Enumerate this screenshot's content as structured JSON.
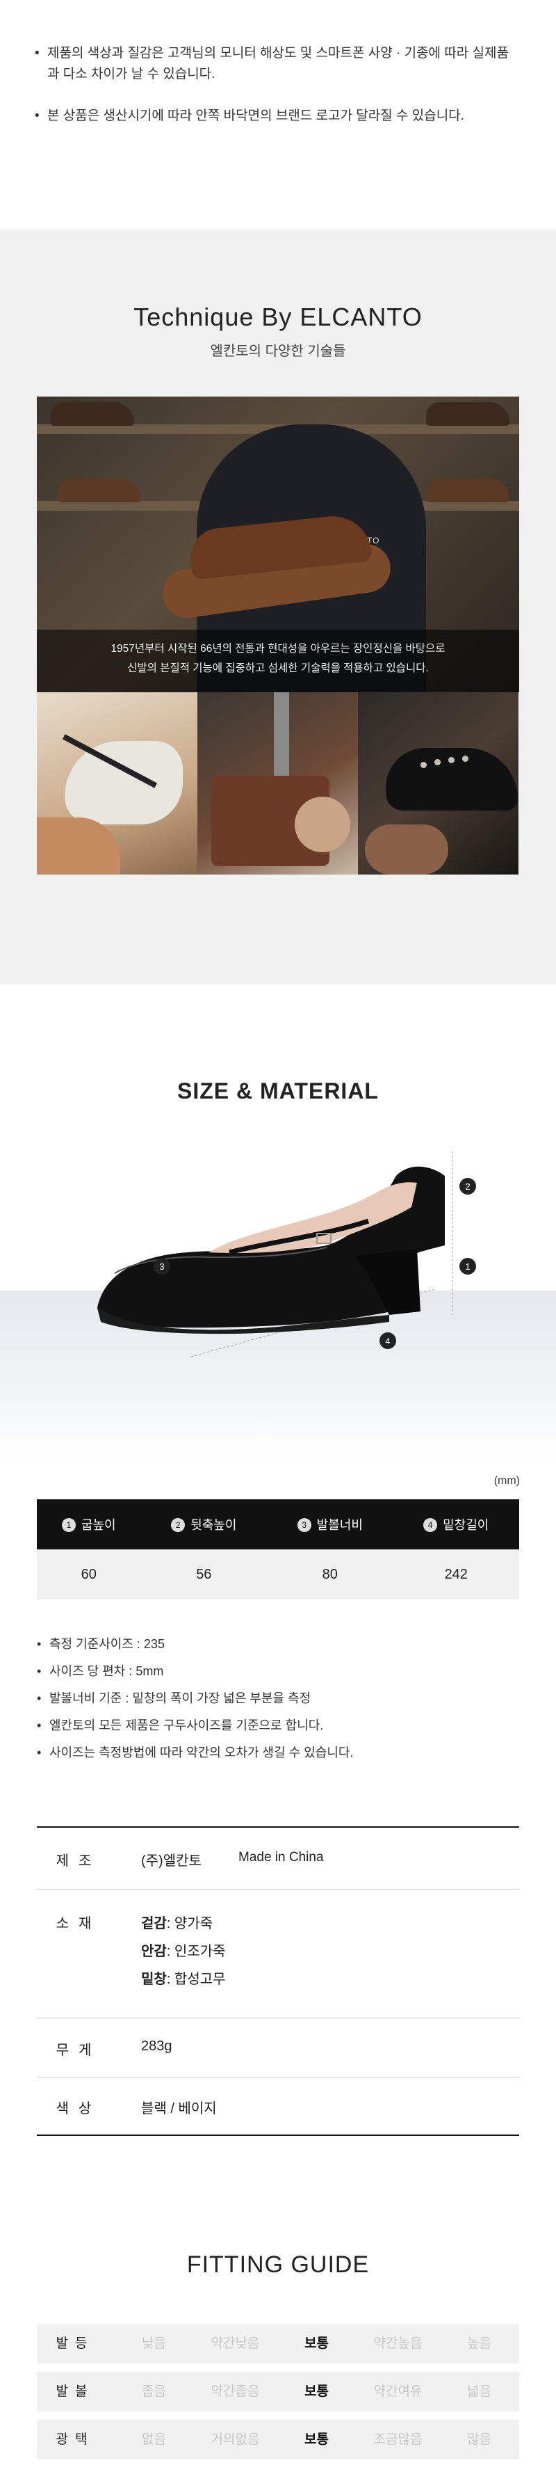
{
  "notice": {
    "items": [
      "제품의 색상과 질감은 고객님의 모니터 해상도 및 스마트폰 사양 · 기종에 따라 실제품과 다소 차이가 날 수 있습니다.",
      "본 상품은 생산시기에 따라 안쪽 바닥면의 브랜드 로고가 달라질 수 있습니다."
    ]
  },
  "technique": {
    "title": "Technique By ELCANTO",
    "subtitle": "엘칸토의 다양한 기술들",
    "caption_line1": "1957년부터 시작된 66년의 전통과 현대성을 아우르는 장인정신을 바탕으로",
    "caption_line2": "신발의 본질적 기능에 집중하고 섬세한 기술력을 적용하고 있습니다.",
    "jacket_logo": "ELCANTO"
  },
  "size": {
    "title": "SIZE & MATERIAL",
    "unit": "(mm)",
    "markers": [
      "1",
      "2",
      "3",
      "4"
    ],
    "headers": [
      {
        "num": "1",
        "label": "굽높이"
      },
      {
        "num": "2",
        "label": "뒷축높이"
      },
      {
        "num": "3",
        "label": "발볼너비"
      },
      {
        "num": "4",
        "label": "밑창길이"
      }
    ],
    "values": [
      "60",
      "56",
      "80",
      "242"
    ],
    "notes": [
      "측정 기준사이즈 : 235",
      "사이즈 당 편차 : 5mm",
      "발볼너비 기준 : 밑창의 폭이 가장 넓은 부분을 측정",
      "엘칸토의 모든 제품은 구두사이즈를 기준으로 합니다.",
      "사이즈는 측정방법에 따라 약간의 오차가 생길 수 있습니다."
    ]
  },
  "info": {
    "maker_label": "제조",
    "maker": "(주)엘칸토",
    "origin": "Made in China",
    "material_label": "소재",
    "outer_key": "겉감",
    "outer_val": ": 양가죽",
    "inner_key": "안감",
    "inner_val": ": 인조가죽",
    "sole_key": "밑창",
    "sole_val": ": 합성고무",
    "weight_label": "무게",
    "weight": "283g",
    "color_label": "색상",
    "color": "블랙 / 베이지"
  },
  "fitting": {
    "title": "FITTING GUIDE",
    "rows": [
      {
        "label": "발등",
        "options": [
          "낮음",
          "약간낮음",
          "보통",
          "약간높음",
          "높음"
        ],
        "selected": 2
      },
      {
        "label": "발볼",
        "options": [
          "좁음",
          "약간좁음",
          "보통",
          "약간여유",
          "넓음"
        ],
        "selected": 2
      },
      {
        "label": "광택",
        "options": [
          "없음",
          "거의없음",
          "보통",
          "조금많음",
          "많음"
        ],
        "selected": 2
      }
    ]
  },
  "colors": {
    "header_bg": "#111111",
    "cell_bg": "#f1f1f1",
    "section_bg": "#f1f1f1",
    "muted_text": "#c8c8c8"
  }
}
